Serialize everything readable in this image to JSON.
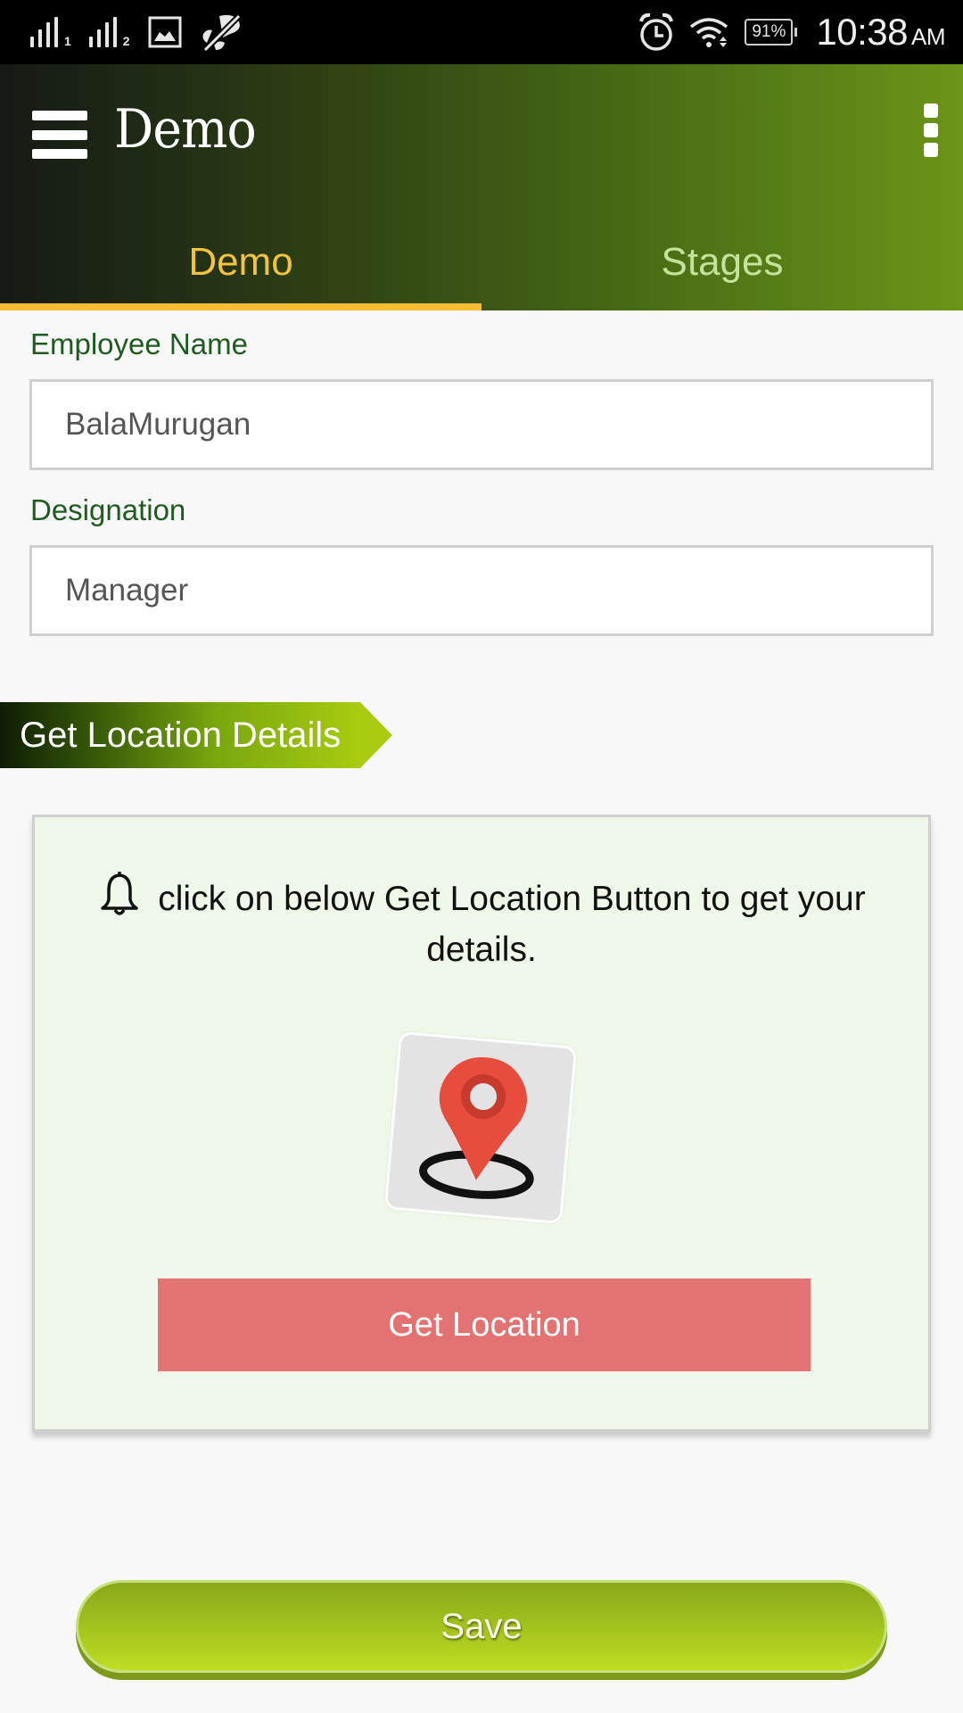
{
  "status_bar": {
    "sim1_label": "1",
    "sim2_label": "2",
    "battery": "91%",
    "time": "10:38",
    "ampm": "AM",
    "icons": [
      "signal-sim1-icon",
      "signal-sim2-icon",
      "image-icon",
      "mute-off-icon",
      "alarm-icon",
      "wifi-icon",
      "battery-icon"
    ]
  },
  "app_bar": {
    "title": "Demo",
    "menu_icon": "hamburger-icon",
    "overflow_icon": "more-vert-icon",
    "colors": {
      "active_tab": "#f2c33d",
      "inactive_tab": "#c4e29a",
      "indicator": "#f7bc32"
    }
  },
  "tabs": [
    {
      "label": "Demo",
      "active": true
    },
    {
      "label": "Stages",
      "active": false
    }
  ],
  "form": {
    "employee_name": {
      "label": "Employee Name",
      "value": "BalaMurugan"
    },
    "designation": {
      "label": "Designation",
      "value": "Manager"
    }
  },
  "location_section": {
    "title": "Get Location Details",
    "notice_icon": "bell-icon",
    "notice_text": "click on below Get Location Button to get your details.",
    "image_icon": "map-pin-icon",
    "button_label": "Get Location",
    "button_color": "#e37272"
  },
  "save_button": {
    "label": "Save",
    "color": "#a2c21e"
  }
}
